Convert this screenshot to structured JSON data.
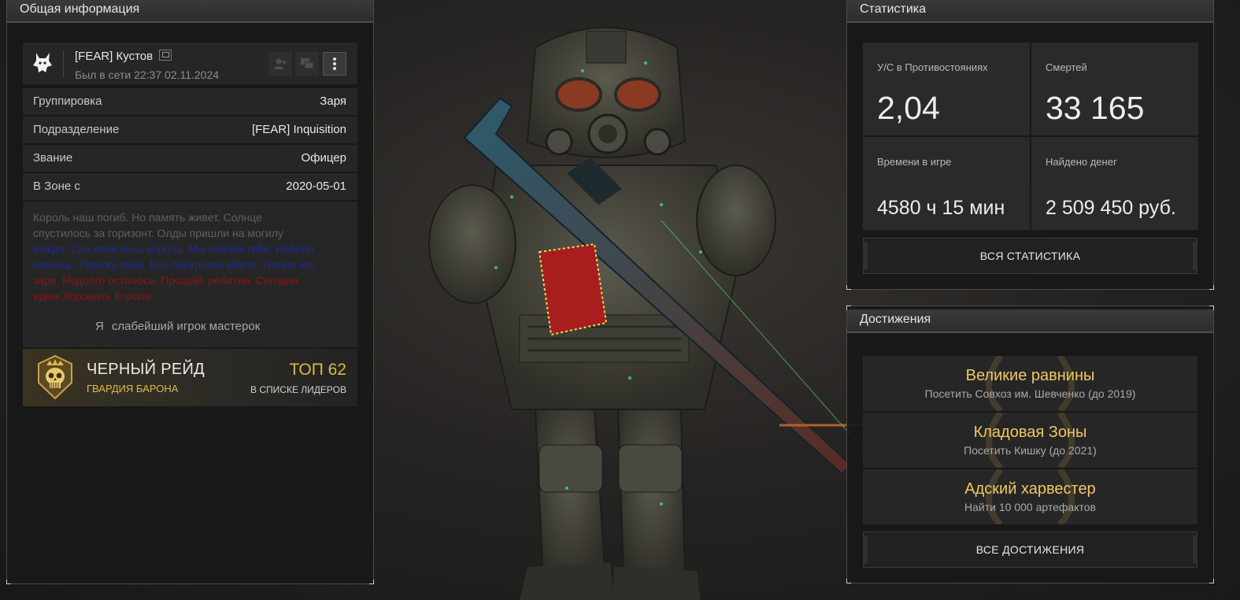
{
  "left_panel": {
    "title": "Общая информация",
    "player": {
      "name": "[FEAR] Кустов",
      "last_online": "Был в сети 22:37 02.11.2024"
    },
    "rows": [
      {
        "key": "Группировка",
        "value": "Заря"
      },
      {
        "key": "Подразделение",
        "value": "[FEAR] Inquisition"
      },
      {
        "key": "Звание",
        "value": "Офицер"
      },
      {
        "key": "В Зоне с",
        "value": "2020-05-01"
      }
    ],
    "bio": {
      "line1": "Король наш погиб. Но память живет. Солнце",
      "line2": "спустилось за горизонт. Олды пришли на могилу",
      "line3": "вождя. Спи спокойно, король. Мы любим тебя. Набери",
      "line4": "помощь. Помогу тебе. Без лекарства мёртв. Потом что",
      "line5": "заря. Недолго осталось. Прощай, ребятня. Сегодня",
      "line6": "идем Хоронить Короля.",
      "status_char": "Я",
      "status_text": "слабейший игрок мастерок"
    },
    "raid": {
      "title": "ЧЕРНЫЙ РЕЙД",
      "subtitle": "ГВАРДИЯ БАРОНА",
      "rank": "ТОП 62",
      "rank_sub": "В СПИСКЕ ЛИДЕРОВ"
    }
  },
  "stats_panel": {
    "title": "Статистика",
    "cells": [
      {
        "label": "У/С в Противостояниях",
        "value": "2,04"
      },
      {
        "label": "Смертей",
        "value": "33 165"
      },
      {
        "label": "Времени в игре",
        "value": "4580 ч 15 мин"
      },
      {
        "label": "Найдено денег",
        "value": "2 509 450 руб."
      }
    ],
    "button": "ВСЯ СТАТИСТИКА"
  },
  "achievements_panel": {
    "title": "Достижения",
    "items": [
      {
        "title": "Великие равнины",
        "desc": "Посетить Совхоз им. Шевченко (до 2019)"
      },
      {
        "title": "Кладовая Зоны",
        "desc": "Посетить Кишку (до 2021)"
      },
      {
        "title": "Адский харвестер",
        "desc": "Найти 10 000 артефактов"
      }
    ],
    "button": "ВСЕ ДОСТИЖЕНИЯ"
  },
  "colors": {
    "accent_gold": "#e0b64a",
    "achievement_gold": "#f0c860",
    "panel_bg": "#262626",
    "bio_blue": "#1f2a8a",
    "bio_red": "#8a1414"
  },
  "icons": {
    "clan_logo": "wolf-icon",
    "copy": "copy-icon",
    "add_friend": "add-friend-icon",
    "message": "chat-icon",
    "more": "more-vertical-icon",
    "raid_emblem": "skull-crown-icon"
  }
}
